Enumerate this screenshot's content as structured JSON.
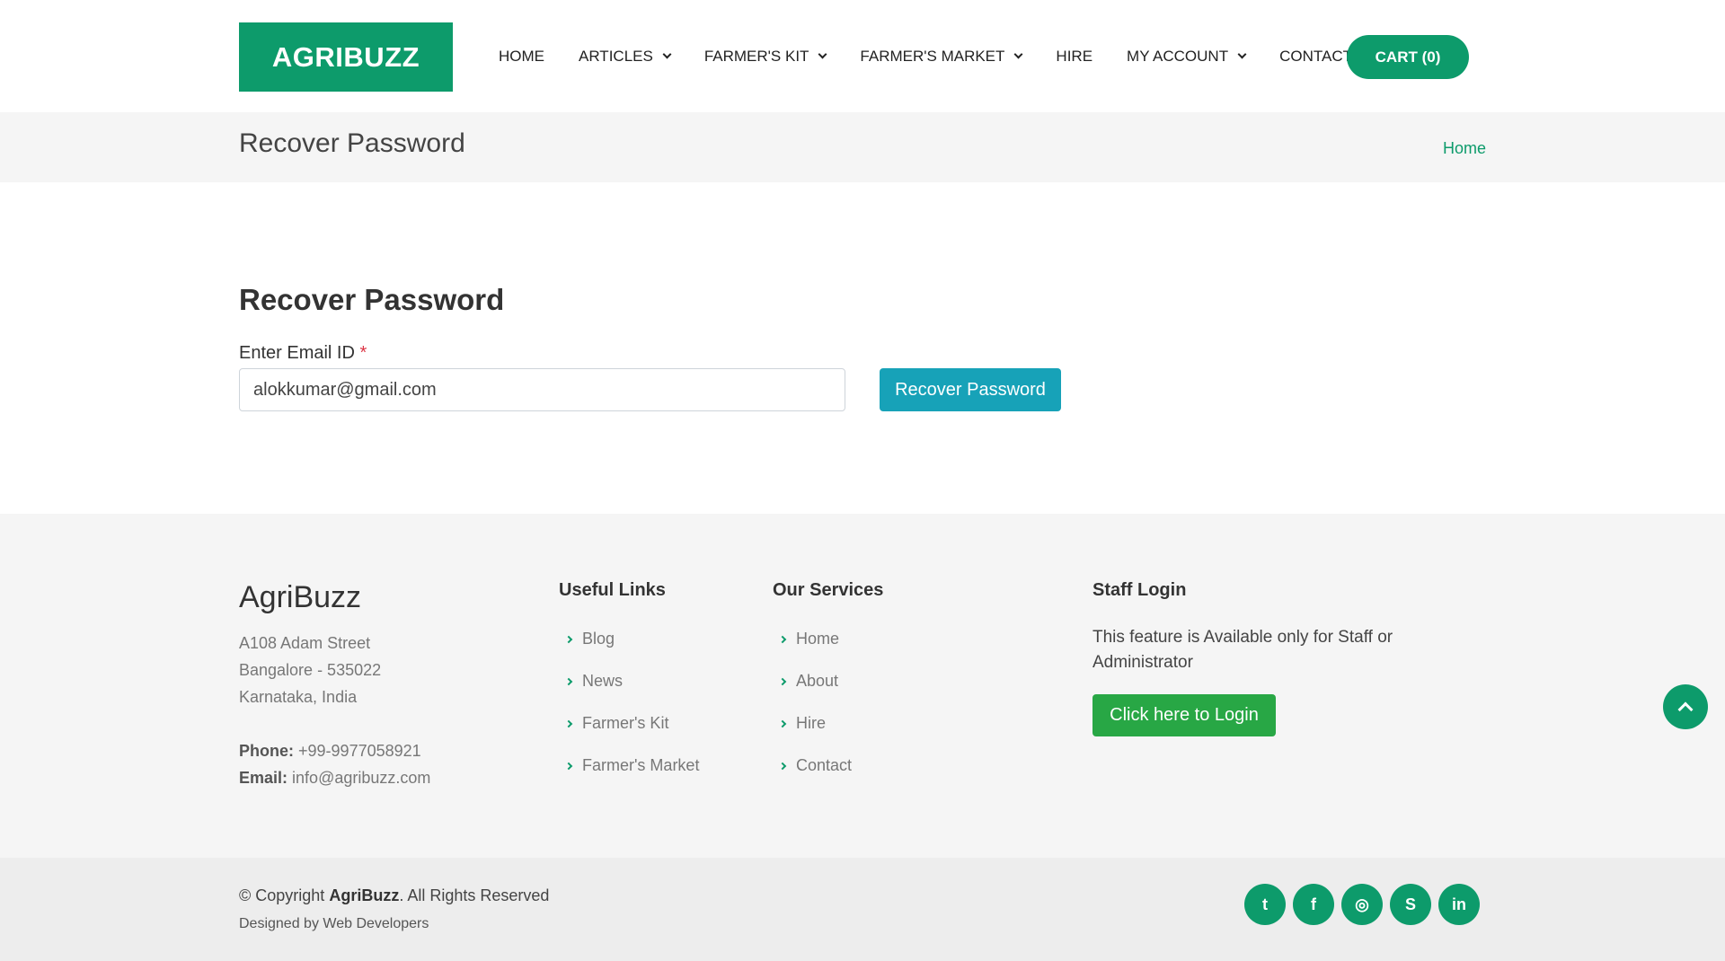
{
  "brand": {
    "logo": "AGRIBUZZ",
    "primary": "#0d9b6b"
  },
  "nav": {
    "items": [
      {
        "label": "HOME",
        "dropdown": false
      },
      {
        "label": "ARTICLES",
        "dropdown": true
      },
      {
        "label": "FARMER'S KIT",
        "dropdown": true
      },
      {
        "label": "FARMER'S MARKET",
        "dropdown": true
      },
      {
        "label": "HIRE",
        "dropdown": false
      },
      {
        "label": "MY ACCOUNT",
        "dropdown": true
      },
      {
        "label": "CONTACT",
        "dropdown": false
      }
    ],
    "cart": "CART (0)"
  },
  "breadcrumb": {
    "title": "Recover Password",
    "home": "Home"
  },
  "form": {
    "title": "Recover Password",
    "email_label": "Enter Email ID",
    "required_mark": "*",
    "email_value": "alokkumar@gmail.com",
    "submit": "Recover Password"
  },
  "footer": {
    "brand": "AgriBuzz",
    "address": [
      "A108 Adam Street",
      "Bangalore - 535022",
      "Karnataka, India"
    ],
    "phone_label": "Phone:",
    "phone": "+99-9977058921",
    "email_label": "Email:",
    "email": "info@agribuzz.com",
    "useful_links": {
      "title": "Useful Links",
      "items": [
        "Blog",
        "News",
        "Farmer's Kit",
        "Farmer's Market"
      ]
    },
    "services": {
      "title": "Our Services",
      "items": [
        "Home",
        "About",
        "Hire",
        "Contact"
      ]
    },
    "staff": {
      "title": "Staff Login",
      "text": "This feature is Available only for Staff or Administrator",
      "button": "Click here to Login"
    }
  },
  "bottom": {
    "copyright_prefix": "© Copyright",
    "copyright_brand": "AgriBuzz",
    "copyright_suffix": ". All Rights Reserved",
    "designed": "Designed by Web Developers",
    "social": [
      {
        "icon": "twitter-icon",
        "glyph": "t"
      },
      {
        "icon": "facebook-icon",
        "glyph": "f"
      },
      {
        "icon": "instagram-icon",
        "glyph": "◎"
      },
      {
        "icon": "skype-icon",
        "glyph": "S"
      },
      {
        "icon": "linkedin-icon",
        "glyph": "in"
      }
    ]
  }
}
